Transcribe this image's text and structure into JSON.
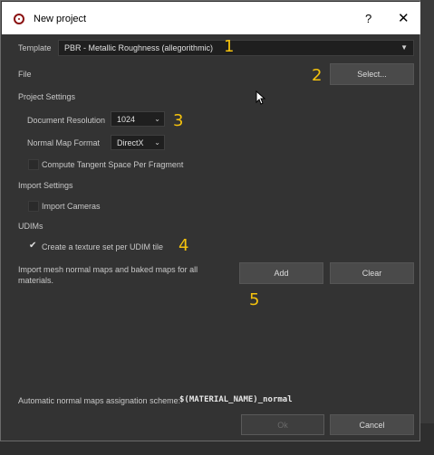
{
  "window": {
    "title": "New project",
    "help_glyph": "?",
    "close_glyph": "✕"
  },
  "template": {
    "label": "Template",
    "value": "PBR - Metallic Roughness (allegorithmic)"
  },
  "file": {
    "label": "File",
    "select_label": "Select..."
  },
  "project_settings": {
    "heading": "Project Settings",
    "doc_res_label": "Document Resolution",
    "doc_res_value": "1024",
    "normal_map_label": "Normal Map Format",
    "normal_map_value": "DirectX",
    "tangent_label": "Compute Tangent Space Per Fragment",
    "tangent_checked": false
  },
  "import_settings": {
    "heading": "Import Settings",
    "cameras_label": "Import Cameras",
    "cameras_checked": false
  },
  "udims": {
    "heading": "UDIMs",
    "texture_set_label": "Create a texture set per UDIM tile",
    "texture_set_checked": true
  },
  "maps": {
    "description": "Import mesh normal maps and baked maps for all materials.",
    "add_label": "Add",
    "clear_label": "Clear"
  },
  "footer": {
    "scheme_label": "Automatic normal maps assignation scheme:",
    "scheme_value": "$(MATERIAL_NAME)_normal",
    "ok_label": "Ok",
    "cancel_label": "Cancel"
  },
  "annotations": [
    "1",
    "2",
    "3",
    "4",
    "5"
  ],
  "colors": {
    "dialog_bg": "#333333",
    "annotation": "#f4c20d",
    "title_bar": "#ffffff"
  }
}
